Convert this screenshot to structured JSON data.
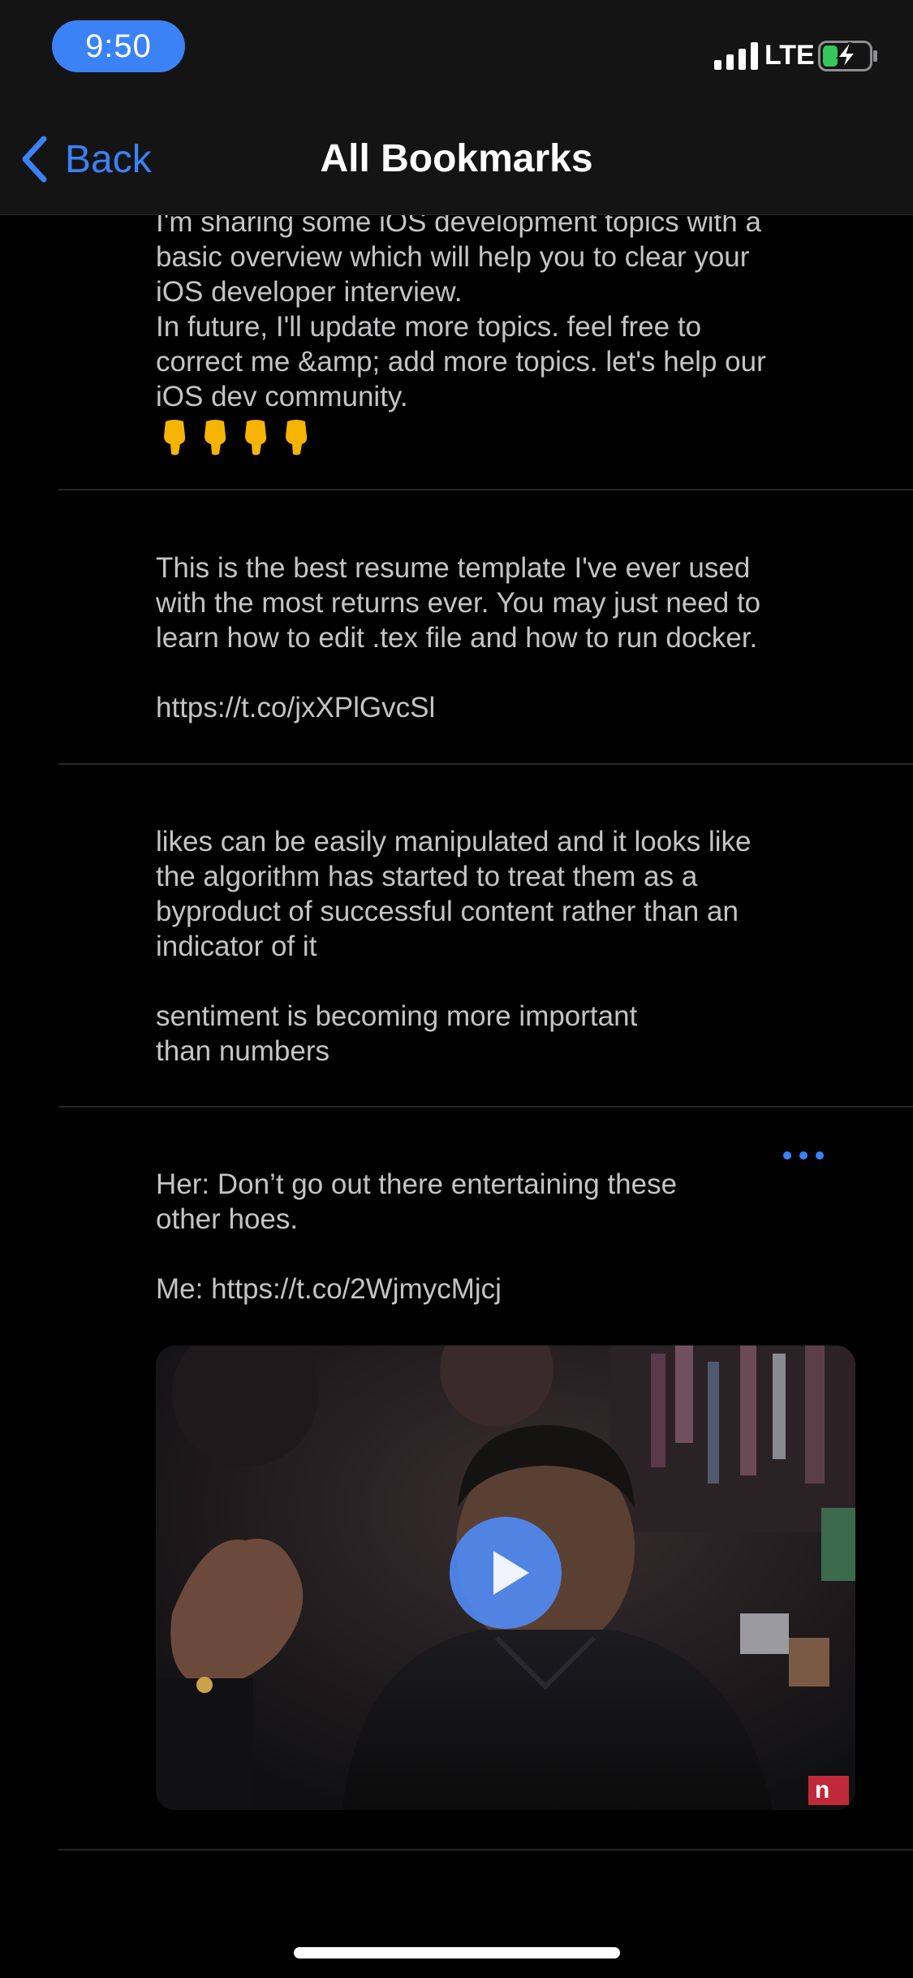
{
  "status_bar": {
    "time": "9:50",
    "network": "LTE",
    "signal_icon": "cellular-signal-icon",
    "battery_icon": "battery-charging-icon"
  },
  "nav": {
    "back_label": "Back",
    "title": "All Bookmarks",
    "back_icon": "chevron-left-icon"
  },
  "bookmarks": [
    {
      "text": "I'm sharing some iOS development topics with a\nbasic overview which will help you to clear your\niOS developer interview.\nIn future, I'll update more topics. feel free to\ncorrect me &amp; add more topics. let's help our\niOS dev community.",
      "emoji": [
        "pointing-down-hand-icon",
        "pointing-down-hand-icon",
        "pointing-down-hand-icon",
        "pointing-down-hand-icon"
      ]
    },
    {
      "text": "This is the best resume template I've ever used\nwith the most returns ever. You may just need to\nlearn how to edit .tex file and how to run docker.\n\nhttps://t.co/jxXPlGvcSl"
    },
    {
      "text": "likes can be easily manipulated and it looks like\nthe algorithm has started to treat them as a\nbyproduct of successful content rather than an\nindicator of it\n\nsentiment is becoming more important\nthan numbers"
    },
    {
      "text": "Her: Don’t go out there entertaining these\nother hoes.\n\nMe: https://t.co/2WjmycMjcj",
      "media": {
        "type": "video",
        "play_icon": "play-icon",
        "watermark": "n"
      },
      "more_icon": "more-horizontal-icon"
    }
  ],
  "colors": {
    "accent": "#3b82f6",
    "background": "#000000",
    "bar_background": "#141414",
    "text": "#c4c4c6",
    "divider": "#262626"
  }
}
